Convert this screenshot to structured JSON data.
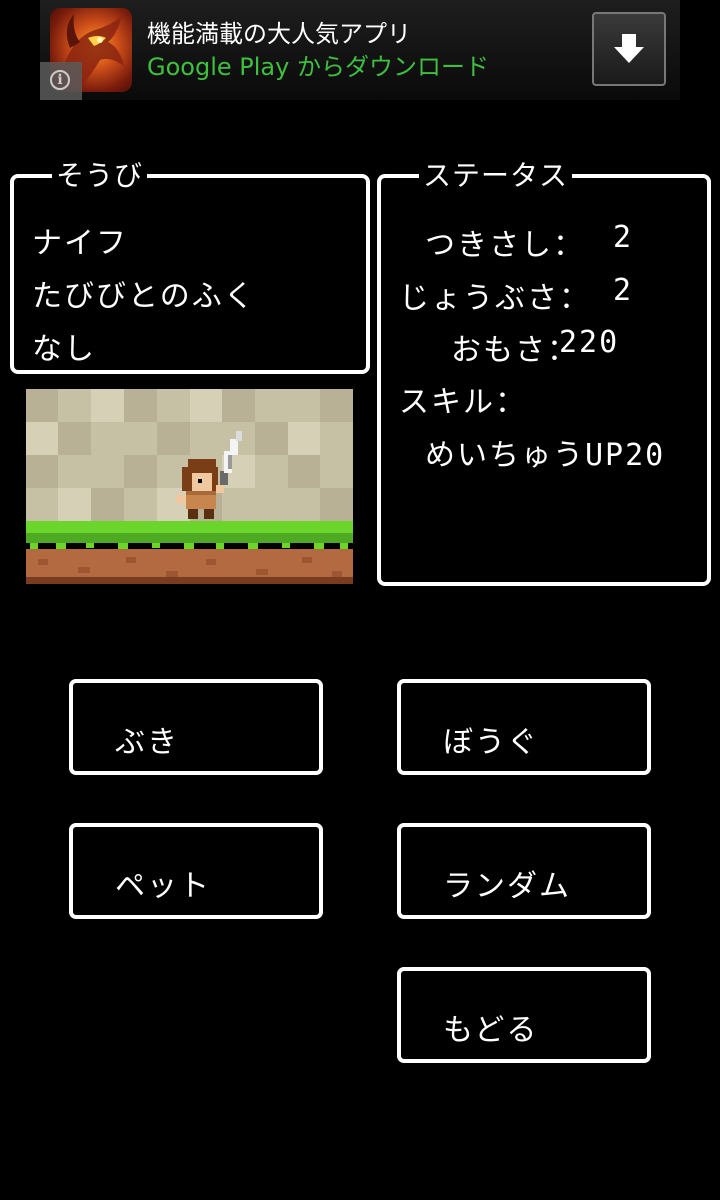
{
  "ad": {
    "icon": "dragon-app-icon",
    "info_icon": "info-icon",
    "title": "機能満載の大人気アプリ",
    "subtitle": "Google Play からダウンロード",
    "download_icon": "download-arrow-icon"
  },
  "equipment": {
    "title": "そうび",
    "weapon": "ナイフ",
    "armor": "たびびとのふく",
    "pet": "なし"
  },
  "status": {
    "title": "ステータス",
    "attack_label": "つきさし：",
    "attack_value": "2",
    "defense_label": "じょうぶさ：",
    "defense_value": "2",
    "weight_label": "おもさ：",
    "weight_value": "220",
    "skill_label": "スキル：",
    "skill_value": "めいちゅうUP20"
  },
  "buttons": {
    "weapon": "ぶき",
    "armor": "ぼうぐ",
    "pet": "ペット",
    "random": "ランダム",
    "back": "もどる"
  },
  "colors": {
    "background": "#000000",
    "frame": "#ffffff",
    "ad_green": "#3fbf3f",
    "grass": "#5ec62a",
    "dirt": "#b0663c",
    "wall": "#c8c2a6"
  }
}
